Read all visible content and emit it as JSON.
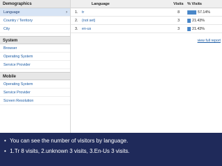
{
  "sidebar": {
    "groups": [
      {
        "title": "Demographics",
        "items": [
          "Language",
          "Country / Territory",
          "City"
        ]
      },
      {
        "title": "System",
        "items": [
          "Browser",
          "Operating System",
          "Service Provider"
        ]
      },
      {
        "title": "Mobile",
        "items": [
          "Operating System",
          "Service Provider",
          "Screen Resolution"
        ]
      }
    ],
    "active_chevron": "›"
  },
  "table": {
    "headers": {
      "language": "Language",
      "visits": "Visits",
      "pct_visits": "% Visits"
    },
    "rows": [
      {
        "rank": "1.",
        "language": "tr",
        "visits": "8",
        "pct": "57.14%",
        "fraction": 0.5714
      },
      {
        "rank": "2.",
        "language": "(not set)",
        "visits": "3",
        "pct": "21.43%",
        "fraction": 0.2143
      },
      {
        "rank": "3.",
        "language": "en-us",
        "visits": "3",
        "pct": "21.43%",
        "fraction": 0.2143
      }
    ],
    "view_full_report": "view full report"
  },
  "caption": {
    "line1": "You can see the number of visitors by language.",
    "line2": "1.Tr  8 visits, 2.unknown 3 visits, 3.En-Us 3 visits.",
    "bullet": "•"
  },
  "colors": {
    "bar": "#4a87c8",
    "caption_bg": "#1f2a5a",
    "active_item": "#d7e4f5"
  }
}
